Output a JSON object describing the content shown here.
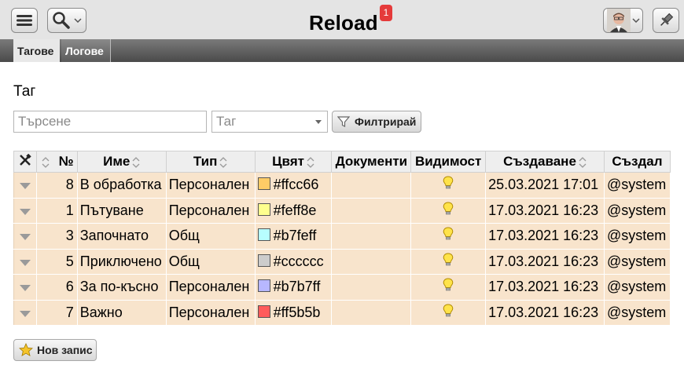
{
  "app": {
    "title": "Reload",
    "notification_count": "1"
  },
  "tabs": [
    {
      "label": "Тагове"
    },
    {
      "label": "Логове"
    }
  ],
  "section_title": "Таг",
  "filter": {
    "search_placeholder": "Търсене",
    "type_placeholder": "Таг",
    "filter_label": "Филтрирай"
  },
  "table": {
    "headers": {
      "num": "№",
      "name": "Име",
      "type": "Тип",
      "color": "Цвят",
      "documents": "Документи",
      "visibility": "Видимост",
      "created": "Създаване",
      "created_by": "Създал"
    },
    "rows": [
      {
        "num": "8",
        "name": "В обработка",
        "type": "Персонален",
        "color": "#ffcc66",
        "documents": "",
        "created": "25.03.2021 17:01",
        "created_by": "@system"
      },
      {
        "num": "1",
        "name": "Пътуване",
        "type": "Персонален",
        "color": "#feff8e",
        "documents": "",
        "created": "17.03.2021 16:23",
        "created_by": "@system"
      },
      {
        "num": "3",
        "name": "Започнато",
        "type": "Общ",
        "color": "#b7feff",
        "documents": "",
        "created": "17.03.2021 16:23",
        "created_by": "@system"
      },
      {
        "num": "5",
        "name": "Приключено",
        "type": "Общ",
        "color": "#cccccc",
        "documents": "",
        "created": "17.03.2021 16:23",
        "created_by": "@system"
      },
      {
        "num": "6",
        "name": "За по-късно",
        "type": "Персонален",
        "color": "#b7b7ff",
        "documents": "",
        "created": "17.03.2021 16:23",
        "created_by": "@system"
      },
      {
        "num": "7",
        "name": "Важно",
        "type": "Персонален",
        "color": "#ff5b5b",
        "documents": "",
        "created": "17.03.2021 16:23",
        "created_by": "@system"
      }
    ]
  },
  "new_record_label": "Нов запис",
  "icons": {
    "menu": "menu-icon",
    "search": "search-icon",
    "pin": "pin-icon",
    "tools": "tools-icon",
    "visibility": "lightbulb-icon",
    "filter": "filter-icon",
    "new": "star-icon",
    "row_menu": "chevron-down-icon"
  }
}
